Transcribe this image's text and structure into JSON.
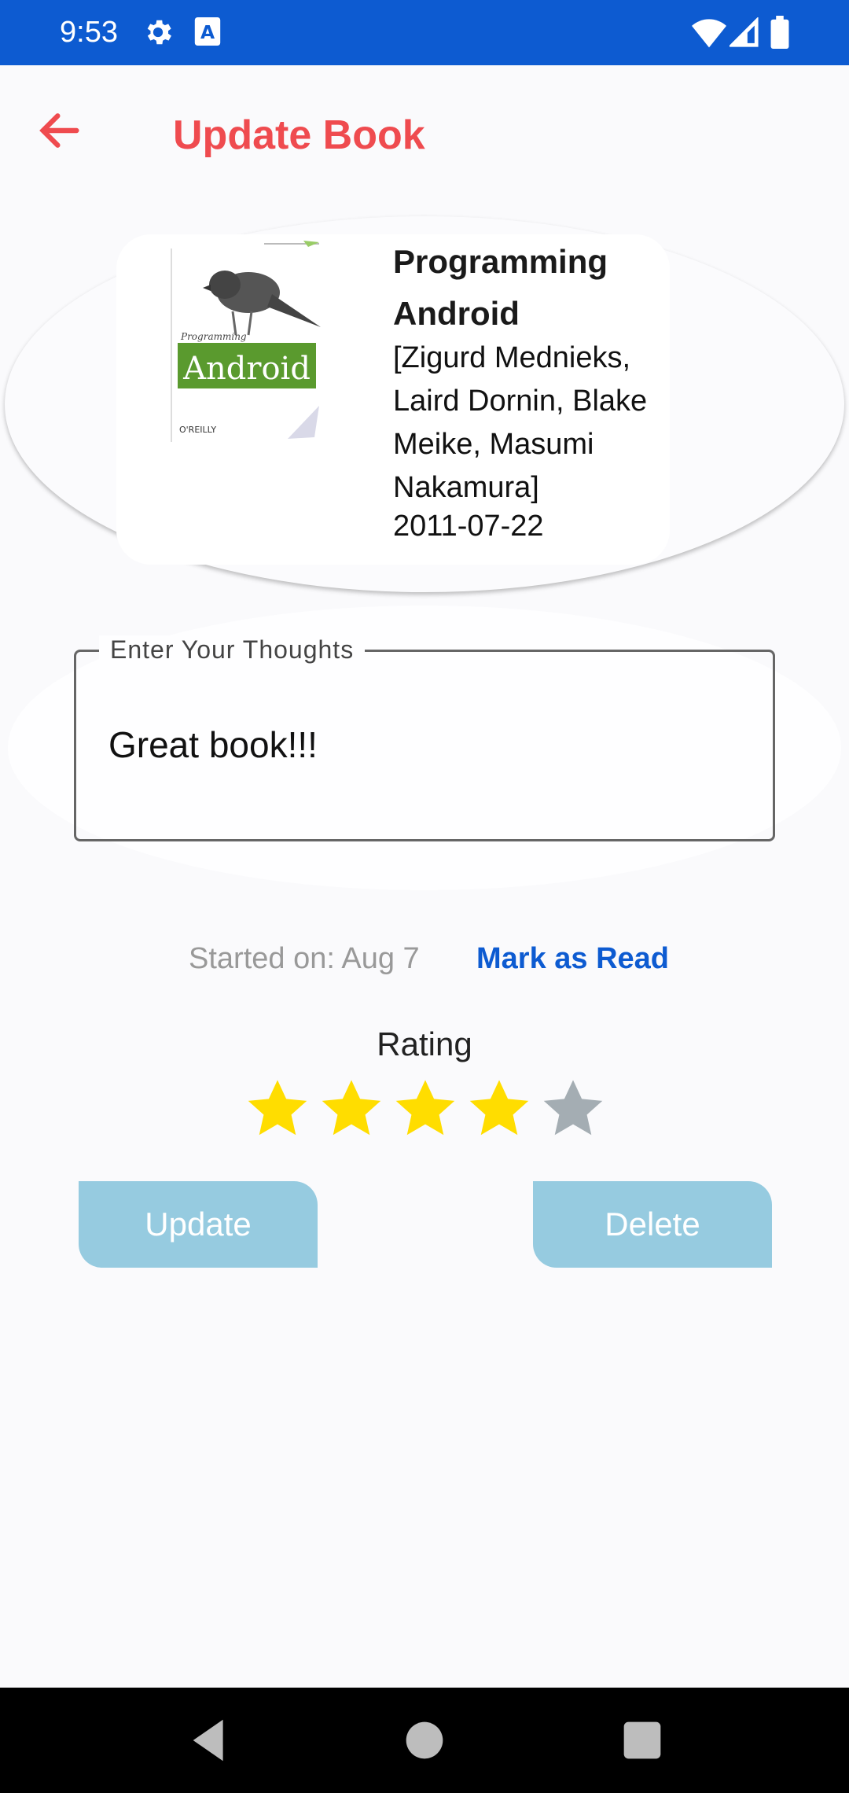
{
  "status_bar": {
    "time": "9:53",
    "icons": [
      "gear-icon",
      "text-a-icon",
      "wifi-icon",
      "signal-icon",
      "battery-icon"
    ]
  },
  "app_bar": {
    "title": "Update Book",
    "back_icon": "arrow-left-icon",
    "accent_color": "#ef4b4f"
  },
  "book": {
    "title": "Programming Android",
    "authors": "[Zigurd Mednieks, Laird Dornin, Blake Meike, Masumi Nakamura]",
    "published": "2011-07-22",
    "cover": {
      "title_word": "Android",
      "small_title": "Programming",
      "publisher": "O'REILLY",
      "cover_accent": "#5a9a2e"
    }
  },
  "thoughts": {
    "label": "Enter Your Thoughts",
    "value": "Great book!!!"
  },
  "reading": {
    "started": "Started on: Aug 7",
    "mark_as_read": "Mark as Read",
    "link_color": "#0d5bd1"
  },
  "rating": {
    "label": "Rating",
    "value": 4,
    "max": 5,
    "filled_color": "#ffdd00",
    "empty_color": "#a4adb3"
  },
  "actions": {
    "update": "Update",
    "delete": "Delete",
    "button_color": "#96cbe0"
  },
  "nav_bar": {
    "icons": [
      "back-triangle-icon",
      "home-circle-icon",
      "recents-square-icon"
    ]
  }
}
